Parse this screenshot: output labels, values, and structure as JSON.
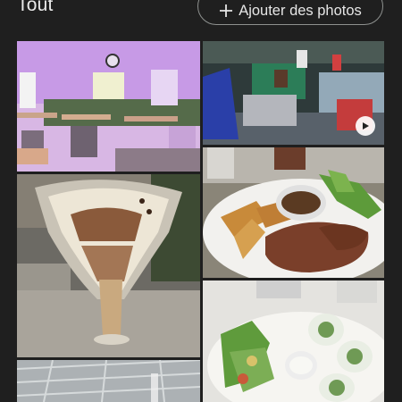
{
  "header": {
    "title": "Tout",
    "add_button_label": "Ajouter des photos",
    "add_icon": "plus-icon"
  },
  "grid": {
    "items": [
      {
        "subject": "restaurant dining room with purple light"
      },
      {
        "subject": "terrace with TV screen",
        "type": "video",
        "badge_icon": "play-icon"
      },
      {
        "subject": "plate of steak with potatoes and salad"
      },
      {
        "subject": "ice cream sundae glass"
      },
      {
        "subject": "salad with eggs and sauce"
      },
      {
        "subject": "glass table top"
      }
    ]
  },
  "colors": {
    "background": "#1f1f1f",
    "text": "#e9e9e9",
    "button_border": "#8e918f"
  }
}
